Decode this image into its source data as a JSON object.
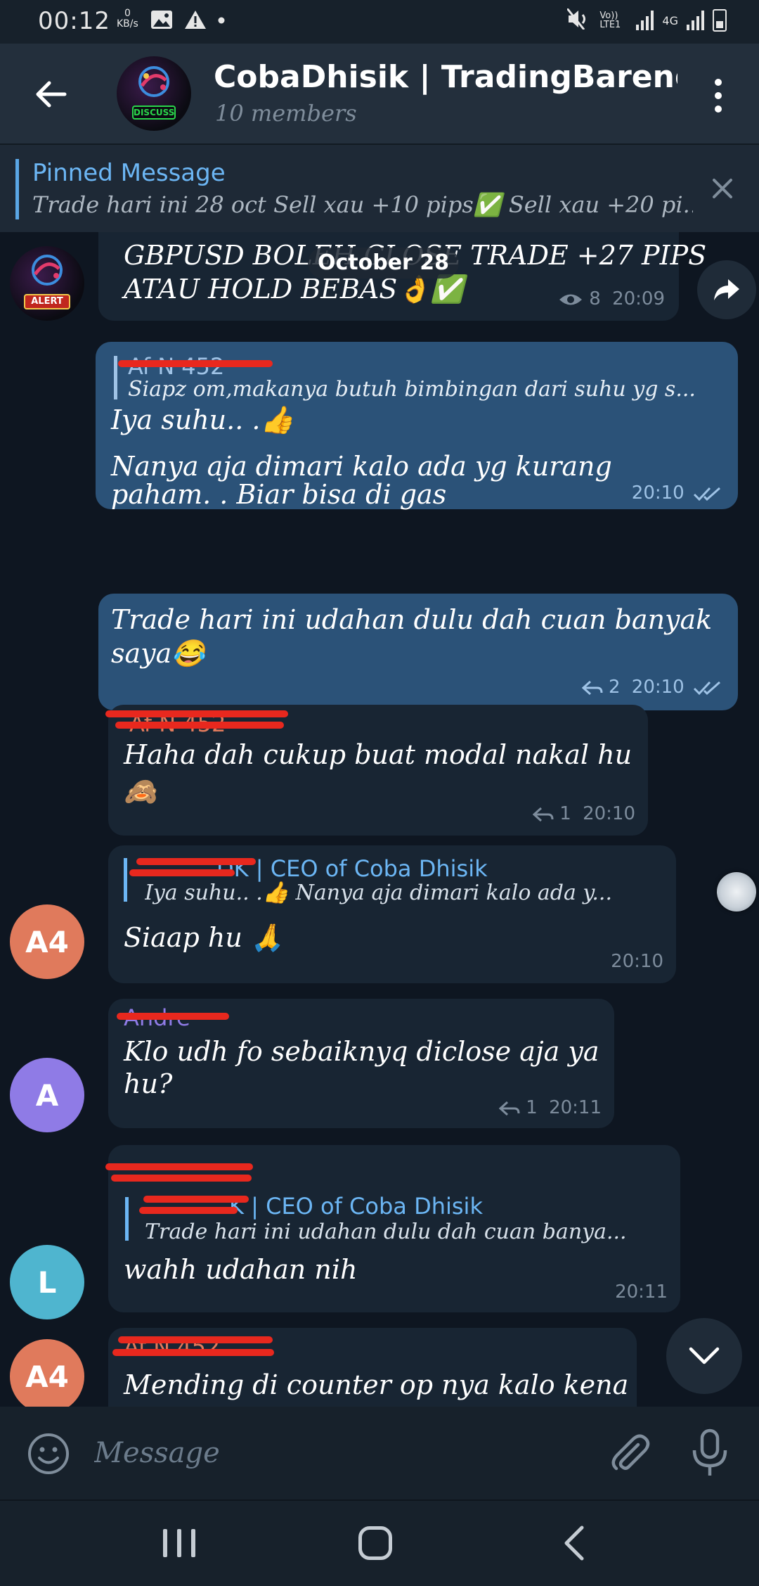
{
  "status_bar": {
    "time": "00:12",
    "net_speed_value": "0",
    "net_speed_unit": "KB/s",
    "volte": "Vo)) LTE1",
    "network": "4G"
  },
  "header": {
    "title": "CobaDhisik | TradingBarengK...",
    "subtitle": "10 members",
    "group_avatar_tag": "DISCUSS"
  },
  "pinned": {
    "label": "Pinned Message",
    "text": "Trade hari ini 28 oct Sell xau +10  pips✅ Sell xau +20 pi..."
  },
  "date_chip": "October 28",
  "messages": [
    {
      "text_line1": "GBPUSD BOLEH CLOSE TRADE +27 PIPS",
      "text_line2": "ATAU HOLD BEBAS👌✅",
      "views": "8",
      "time": "20:09",
      "avatar_tag": "ALERT"
    },
    {
      "quote_name": "Af N 452",
      "quote_text": "Siapz om,makanya butuh bimbingan dari suhu yg s...",
      "line1": "Iya suhu.. .👍",
      "line2": "Nanya aja dimari kalo ada yg kurang",
      "line3": "paham. . Biar bisa di gas",
      "time": "20:10"
    },
    {
      "line1": "Trade hari ini udahan dulu dah cuan banyak",
      "line2": "saya😂",
      "replies": "2",
      "time": "20:10"
    },
    {
      "sender": "Af N 452",
      "line1": "Haha dah cukup buat modal nakal hu",
      "line2": "🙈",
      "replies": "1",
      "time": "20:10"
    },
    {
      "quote_name": "DK | CEO of Coba Dhisik",
      "quote_text": "Iya suhu.. .👍  Nanya aja dimari kalo ada y...",
      "line1": "Siaap hu 🙏",
      "time": "20:10",
      "avatar": "A4"
    },
    {
      "sender": "Andre",
      "line1": "Klo udh fo sebaiknyq diclose aja ya",
      "line2": "hu?",
      "replies": "1",
      "time": "20:11",
      "avatar": "A"
    },
    {
      "quote_name": "K | CEO of Coba Dhisik",
      "quote_text": "Trade hari ini udahan dulu dah cuan banya...",
      "line1": "wahh udahan nih",
      "time": "20:11",
      "avatar": "L"
    },
    {
      "sender": "Af N 452",
      "line1": "Mending di counter op nya kalo kena",
      "avatar": "A4"
    }
  ],
  "composer": {
    "placeholder": "Message"
  },
  "colors": {
    "background": "#0e1621",
    "incoming_bubble": "#182533",
    "outgoing_bubble": "#2b5278",
    "accent": "#6cb6f4",
    "avatar_a4": "#e07a5c",
    "avatar_a": "#8f7be6",
    "avatar_l": "#4fb5cf"
  }
}
